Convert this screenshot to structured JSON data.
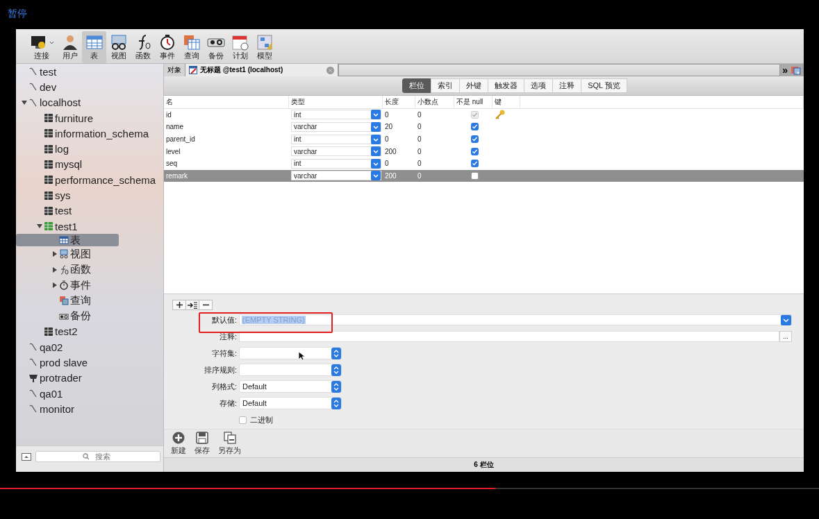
{
  "player": {
    "status": "暂停",
    "progress": {
      "level": 0.605
    }
  },
  "toolbar": [
    {
      "kind": "connection",
      "label": "连接",
      "selected": false,
      "dropdown": true
    },
    {
      "kind": "user",
      "label": "用户",
      "selected": false,
      "dropdown": false
    },
    {
      "kind": "table",
      "label": "表",
      "selected": true,
      "dropdown": false
    },
    {
      "kind": "view",
      "label": "视图",
      "selected": false,
      "dropdown": false
    },
    {
      "kind": "function",
      "label": "函数",
      "selected": false,
      "dropdown": false
    },
    {
      "kind": "event",
      "label": "事件",
      "selected": false,
      "dropdown": false
    },
    {
      "kind": "query",
      "label": "查询",
      "selected": false,
      "dropdown": false
    },
    {
      "kind": "backup",
      "label": "备份",
      "selected": false,
      "dropdown": false
    },
    {
      "kind": "schedule",
      "label": "计划",
      "selected": false,
      "dropdown": false
    },
    {
      "kind": "model",
      "label": "模型",
      "selected": false,
      "dropdown": false
    }
  ],
  "sidebar": {
    "items": [
      {
        "kind": "connection",
        "label": "test",
        "selected": false
      },
      {
        "kind": "connection",
        "label": "dev",
        "selected": false
      },
      {
        "kind": "connection",
        "label": "localhost",
        "selected": false,
        "expanded": true,
        "children": [
          {
            "kind": "database",
            "label": "furniture",
            "selected": false
          },
          {
            "kind": "database",
            "label": "information_schema",
            "selected": false
          },
          {
            "kind": "database",
            "label": "log",
            "selected": false
          },
          {
            "kind": "database",
            "label": "mysql",
            "selected": false
          },
          {
            "kind": "database",
            "label": "performance_schema",
            "selected": false
          },
          {
            "kind": "database",
            "label": "sys",
            "selected": false
          },
          {
            "kind": "database",
            "label": "test",
            "selected": false
          },
          {
            "kind": "database-open",
            "label": "test1",
            "selected": false,
            "expanded": true,
            "children": [
              {
                "kind": "table",
                "label": "表",
                "selected": true
              },
              {
                "kind": "view",
                "label": "视图",
                "selected": false,
                "expanded": false
              },
              {
                "kind": "function",
                "label": "函数",
                "selected": false,
                "expanded": false
              },
              {
                "kind": "event",
                "label": "事件",
                "selected": false,
                "expanded": false
              },
              {
                "kind": "query",
                "label": "查询",
                "selected": false
              },
              {
                "kind": "backup",
                "label": "备份",
                "selected": false
              }
            ]
          },
          {
            "kind": "database",
            "label": "test2",
            "selected": false
          }
        ]
      },
      {
        "kind": "connection",
        "label": "qa02",
        "selected": false
      },
      {
        "kind": "connection",
        "label": "prod slave",
        "selected": false
      },
      {
        "kind": "server",
        "label": "protrader",
        "selected": false
      },
      {
        "kind": "connection",
        "label": "qa01",
        "selected": false
      },
      {
        "kind": "connection",
        "label": "monitor",
        "selected": false
      }
    ],
    "search": {
      "placeholder": "搜索"
    }
  },
  "tabs": [
    {
      "label": "对象",
      "selected": false,
      "closable": false
    },
    {
      "label": "无标题 @test1 (localhost)",
      "selected": true,
      "closable": true
    }
  ],
  "tabs_overflow": "»",
  "subtabs": [
    {
      "label": "栏位",
      "selected": true
    },
    {
      "label": "索引",
      "selected": false
    },
    {
      "label": "外键",
      "selected": false
    },
    {
      "label": "触发器",
      "selected": false
    },
    {
      "label": "选项",
      "selected": false
    },
    {
      "label": "注释",
      "selected": false
    },
    {
      "label": "SQL 预览",
      "selected": false
    }
  ],
  "table": {
    "columns": [
      "名",
      "类型",
      "长度",
      "小数点",
      "不是 null",
      "键"
    ],
    "rows": [
      {
        "name": "id",
        "type": "int",
        "length": "0",
        "decimals": "0",
        "not_null": true,
        "not_null_disabled": true,
        "key": true,
        "selected": false
      },
      {
        "name": "name",
        "type": "varchar",
        "length": "20",
        "decimals": "0",
        "not_null": true,
        "not_null_disabled": false,
        "key": false,
        "selected": false
      },
      {
        "name": "parent_id",
        "type": "int",
        "length": "0",
        "decimals": "0",
        "not_null": true,
        "not_null_disabled": false,
        "key": false,
        "selected": false
      },
      {
        "name": "level",
        "type": "varchar",
        "length": "200",
        "decimals": "0",
        "not_null": true,
        "not_null_disabled": false,
        "key": false,
        "selected": false
      },
      {
        "name": "seq",
        "type": "int",
        "length": "0",
        "decimals": "0",
        "not_null": true,
        "not_null_disabled": false,
        "key": false,
        "selected": false
      },
      {
        "name": "remark",
        "type": "varchar",
        "length": "200",
        "decimals": "0",
        "not_null": false,
        "not_null_disabled": false,
        "key": false,
        "selected": true
      }
    ]
  },
  "properties": [
    {
      "kind": "combo",
      "label": "默认值:",
      "value": "(EMPTY STRING)",
      "highlighted": true
    },
    {
      "kind": "text",
      "label": "注释:",
      "button": "..."
    },
    {
      "kind": "select",
      "label": "字符集:"
    },
    {
      "kind": "select",
      "label": "排序规则:"
    },
    {
      "kind": "select",
      "label": "列格式:",
      "value": "Default"
    },
    {
      "kind": "select",
      "label": "存储:",
      "value": "Default"
    },
    {
      "kind": "checkbox",
      "label": "二进制",
      "checked": false
    }
  ],
  "actions": [
    {
      "kind": "new",
      "label": "新建"
    },
    {
      "kind": "save",
      "label": "保存"
    },
    {
      "kind": "save-as",
      "label": "另存为"
    }
  ],
  "status_bar": "6 栏位"
}
